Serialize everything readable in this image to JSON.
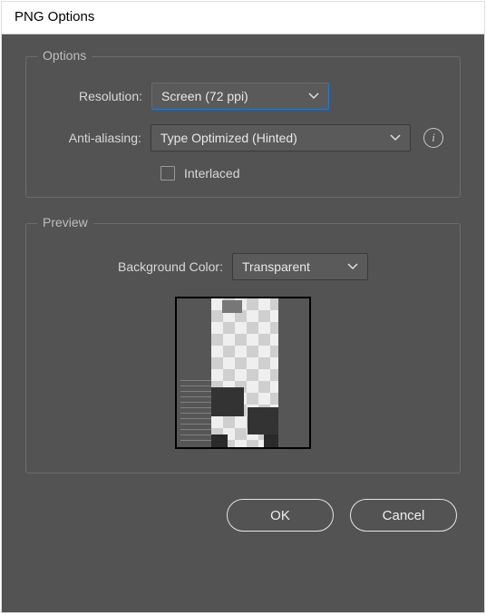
{
  "dialog": {
    "title": "PNG Options"
  },
  "options": {
    "group_title": "Options",
    "resolution_label": "Resolution:",
    "resolution_value": "Screen (72 ppi)",
    "antialias_label": "Anti-aliasing:",
    "antialias_value": "Type Optimized (Hinted)",
    "interlaced_label": "Interlaced",
    "interlaced_checked": false
  },
  "preview": {
    "group_title": "Preview",
    "bgcolor_label": "Background Color:",
    "bgcolor_value": "Transparent"
  },
  "footer": {
    "ok_label": "OK",
    "cancel_label": "Cancel"
  }
}
